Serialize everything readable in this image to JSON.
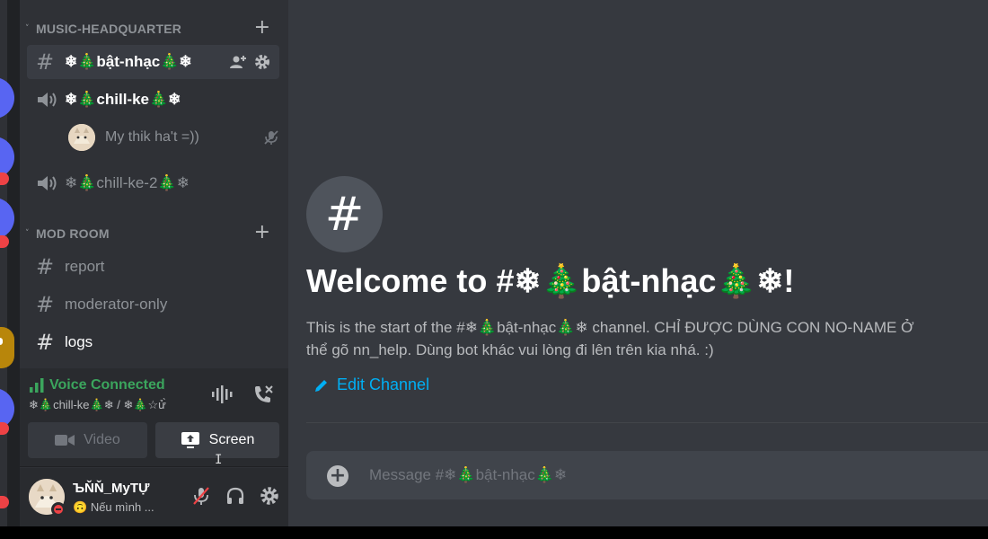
{
  "categories": [
    {
      "label": "MUSIC-HEADQUARTER"
    },
    {
      "label": "MOD ROOM"
    }
  ],
  "channels": {
    "bat_nhac": "❄🎄bật-nhạc🎄❄",
    "chill_ke": "❄🎄chill-ke🎄❄",
    "chill_ke_2": "❄🎄chill-ke-2🎄❄",
    "report": "report",
    "moderator_only": "moderator-only",
    "logs": "logs"
  },
  "voice_member": {
    "name": "My thik ha't =))"
  },
  "voice_panel": {
    "status": "Voice Connected",
    "subtitle": "❄🎄chill-ke🎄❄ / ❄🎄☆ử̀",
    "video_label": "Video",
    "screen_label": "Screen"
  },
  "user": {
    "name": "ЪŇŇ_MyTỰ",
    "status_emoji": "🙃",
    "status_text": "Nếu mình ..."
  },
  "main": {
    "hero_glyph": "#",
    "welcome": "Welcome to #❄🎄bật-nhạc🎄❄!",
    "desc_line1": "This is the start of the #❄🎄bật-nhạc🎄❄ channel. CHỈ ĐƯỢC DÙNG CON NO-NAME Ở",
    "desc_line2": "thể gõ nn_help. Dùng bot khác vui lòng đi lên trên kia nhá. :)",
    "edit_label": "Edit Channel",
    "composer_placeholder": "Message #❄🎄bật-nhạc🎄❄"
  },
  "colors": {
    "sidebar_bg": "#2f3136",
    "main_bg": "#36393f",
    "voice_green": "#3ba55d",
    "link_blue": "#00aff4",
    "dnd_red": "#ed4245"
  }
}
